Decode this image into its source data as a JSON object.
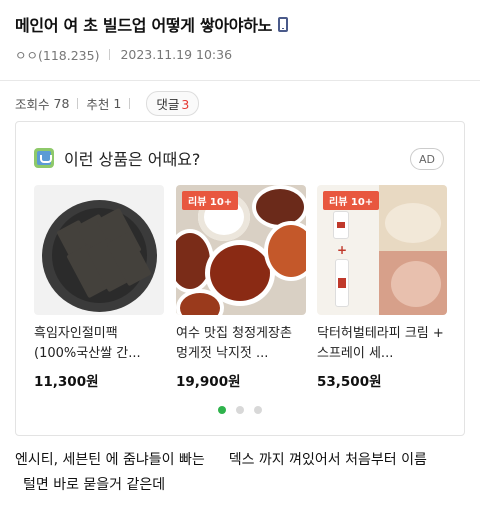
{
  "post": {
    "title": "메인어 여 초 빌드업 어떻게 쌓아야하노",
    "author": "ㅇㅇ(118.235)",
    "datetime": "2023.11.19 10:36"
  },
  "stats": {
    "views_label": "조회수",
    "views": "78",
    "likes_label": "추천",
    "likes": "1",
    "comments_label": "댓글",
    "comments": "3"
  },
  "ad": {
    "heading": "이런 상품은 어때요?",
    "badge": "AD",
    "products": [
      {
        "name": "흑임자인절미팩 (100%국산쌀 간...",
        "price": "11,300원",
        "tag": ""
      },
      {
        "name": "여수 맛집 청정게장촌 멍게젓 낙지젓 ...",
        "price": "19,900원",
        "tag": "리뷰 10+"
      },
      {
        "name": "닥터허벌테라피 크림 + 스프레이 세...",
        "price": "53,500원",
        "tag": "리뷰 10+"
      }
    ],
    "pager_count": 3,
    "pager_active": 1
  },
  "body": {
    "line1_a": "엔시티, 세븐틴",
    "line1_b": "에 줌냐들이 빠는",
    "line1_c": "덱스",
    "line1_d": "까지 껴있어서 처음부터 이름",
    "line2": "털면 바로 묻을거 같은데"
  },
  "colors": {
    "accent_red": "#e53935",
    "review_tag": "#e8573f",
    "pager_active": "#2fb34c"
  }
}
